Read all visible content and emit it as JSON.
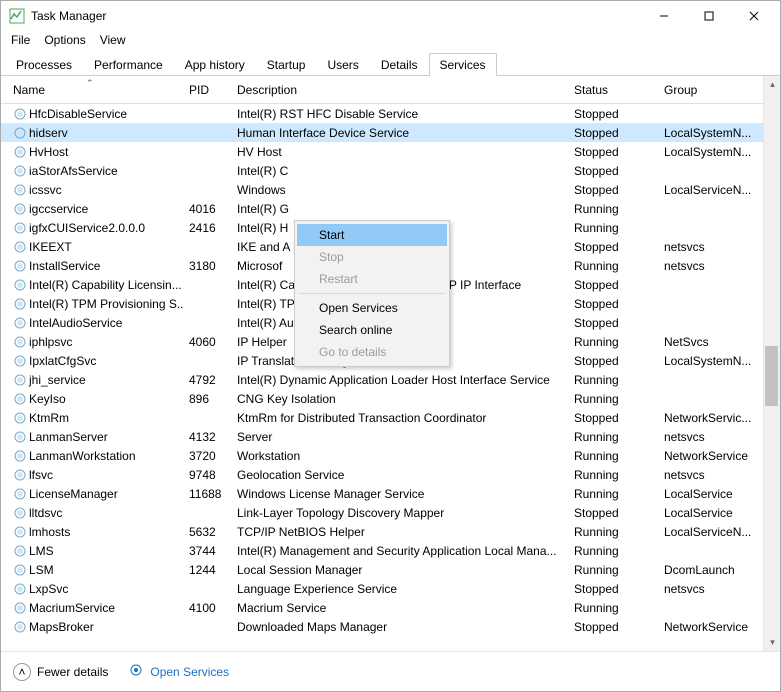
{
  "window": {
    "title": "Task Manager",
    "min_tip": "Minimize",
    "max_tip": "Maximize",
    "close_tip": "Close"
  },
  "menu": {
    "file": "File",
    "options": "Options",
    "view": "View"
  },
  "tabs": {
    "items": [
      "Processes",
      "Performance",
      "App history",
      "Startup",
      "Users",
      "Details",
      "Services"
    ],
    "active": 6
  },
  "columns": {
    "name": "Name",
    "pid": "PID",
    "desc": "Description",
    "status": "Status",
    "group": "Group"
  },
  "selected_row": 1,
  "services": [
    {
      "name": "HfcDisableService",
      "pid": "",
      "desc": "Intel(R) RST HFC Disable Service",
      "status": "Stopped",
      "group": ""
    },
    {
      "name": "hidserv",
      "pid": "",
      "desc": "Human Interface Device Service",
      "status": "Stopped",
      "group": "LocalSystemN..."
    },
    {
      "name": "HvHost",
      "pid": "",
      "desc": "HV Host",
      "status": "Stopped",
      "group": "LocalSystemN..."
    },
    {
      "name": "iaStorAfsService",
      "pid": "",
      "desc": "Intel(R) C",
      "status": "Stopped",
      "group": ""
    },
    {
      "name": "icssvc",
      "pid": "",
      "desc": "Windows",
      "status": "Stopped",
      "group": "LocalServiceN..."
    },
    {
      "name": "igccservice",
      "pid": "4016",
      "desc": "Intel(R) G",
      "status": "Running",
      "group": ""
    },
    {
      "name": "igfxCUIService2.0.0.0",
      "pid": "2416",
      "desc": "Intel(R) H",
      "status": "Running",
      "group": ""
    },
    {
      "name": "IKEEXT",
      "pid": "",
      "desc": "IKE and A",
      "status": "Stopped",
      "group": "netsvcs"
    },
    {
      "name": "InstallService",
      "pid": "3180",
      "desc": "Microsof",
      "status": "Running",
      "group": "netsvcs"
    },
    {
      "name": "Intel(R) Capability Licensin...",
      "pid": "",
      "desc": "Intel(R) Capability Licensing Service TCP IP Interface",
      "status": "Stopped",
      "group": ""
    },
    {
      "name": "Intel(R) TPM Provisioning S...",
      "pid": "",
      "desc": "Intel(R) TPM Provisioning Service",
      "status": "Stopped",
      "group": ""
    },
    {
      "name": "IntelAudioService",
      "pid": "",
      "desc": "Intel(R) Audio Service",
      "status": "Stopped",
      "group": ""
    },
    {
      "name": "iphlpsvc",
      "pid": "4060",
      "desc": "IP Helper",
      "status": "Running",
      "group": "NetSvcs"
    },
    {
      "name": "IpxlatCfgSvc",
      "pid": "",
      "desc": "IP Translation Configuration Service",
      "status": "Stopped",
      "group": "LocalSystemN..."
    },
    {
      "name": "jhi_service",
      "pid": "4792",
      "desc": "Intel(R) Dynamic Application Loader Host Interface Service",
      "status": "Running",
      "group": ""
    },
    {
      "name": "KeyIso",
      "pid": "896",
      "desc": "CNG Key Isolation",
      "status": "Running",
      "group": ""
    },
    {
      "name": "KtmRm",
      "pid": "",
      "desc": "KtmRm for Distributed Transaction Coordinator",
      "status": "Stopped",
      "group": "NetworkServic..."
    },
    {
      "name": "LanmanServer",
      "pid": "4132",
      "desc": "Server",
      "status": "Running",
      "group": "netsvcs"
    },
    {
      "name": "LanmanWorkstation",
      "pid": "3720",
      "desc": "Workstation",
      "status": "Running",
      "group": "NetworkService"
    },
    {
      "name": "lfsvc",
      "pid": "9748",
      "desc": "Geolocation Service",
      "status": "Running",
      "group": "netsvcs"
    },
    {
      "name": "LicenseManager",
      "pid": "11688",
      "desc": "Windows License Manager Service",
      "status": "Running",
      "group": "LocalService"
    },
    {
      "name": "lltdsvc",
      "pid": "",
      "desc": "Link-Layer Topology Discovery Mapper",
      "status": "Stopped",
      "group": "LocalService"
    },
    {
      "name": "lmhosts",
      "pid": "5632",
      "desc": "TCP/IP NetBIOS Helper",
      "status": "Running",
      "group": "LocalServiceN..."
    },
    {
      "name": "LMS",
      "pid": "3744",
      "desc": "Intel(R) Management and Security Application Local Mana...",
      "status": "Running",
      "group": ""
    },
    {
      "name": "LSM",
      "pid": "1244",
      "desc": "Local Session Manager",
      "status": "Running",
      "group": "DcomLaunch"
    },
    {
      "name": "LxpSvc",
      "pid": "",
      "desc": "Language Experience Service",
      "status": "Stopped",
      "group": "netsvcs"
    },
    {
      "name": "MacriumService",
      "pid": "4100",
      "desc": "Macrium Service",
      "status": "Running",
      "group": ""
    },
    {
      "name": "MapsBroker",
      "pid": "",
      "desc": "Downloaded Maps Manager",
      "status": "Stopped",
      "group": "NetworkService"
    }
  ],
  "context_menu": {
    "start": "Start",
    "stop": "Stop",
    "restart": "Restart",
    "open_services": "Open Services",
    "search_online": "Search online",
    "go_to_details": "Go to details"
  },
  "footer": {
    "fewer": "Fewer details",
    "open_services": "Open Services"
  }
}
